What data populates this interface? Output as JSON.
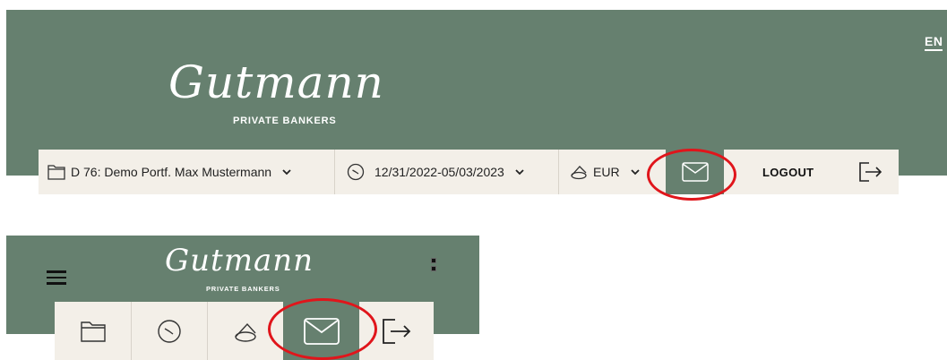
{
  "language": "EN",
  "logo": {
    "script": "Gutmann",
    "subtitle": "PRIVATE BANKERS"
  },
  "toolbar": {
    "portfolio": "D 76: Demo Portf. Max Mustermann",
    "date_range": "12/31/2022-05/03/2023",
    "currency": "EUR",
    "logout": "LOGOUT"
  },
  "icons": [
    "folder-icon",
    "clock-icon",
    "coins-icon",
    "mail-icon",
    "logout-icon",
    "chevron-down-icon",
    "menu-icon",
    "more-icon"
  ],
  "colors": {
    "header_green": "#66806f",
    "toolbar_bg": "#f3efe8",
    "highlight_ring": "#e0151b"
  }
}
